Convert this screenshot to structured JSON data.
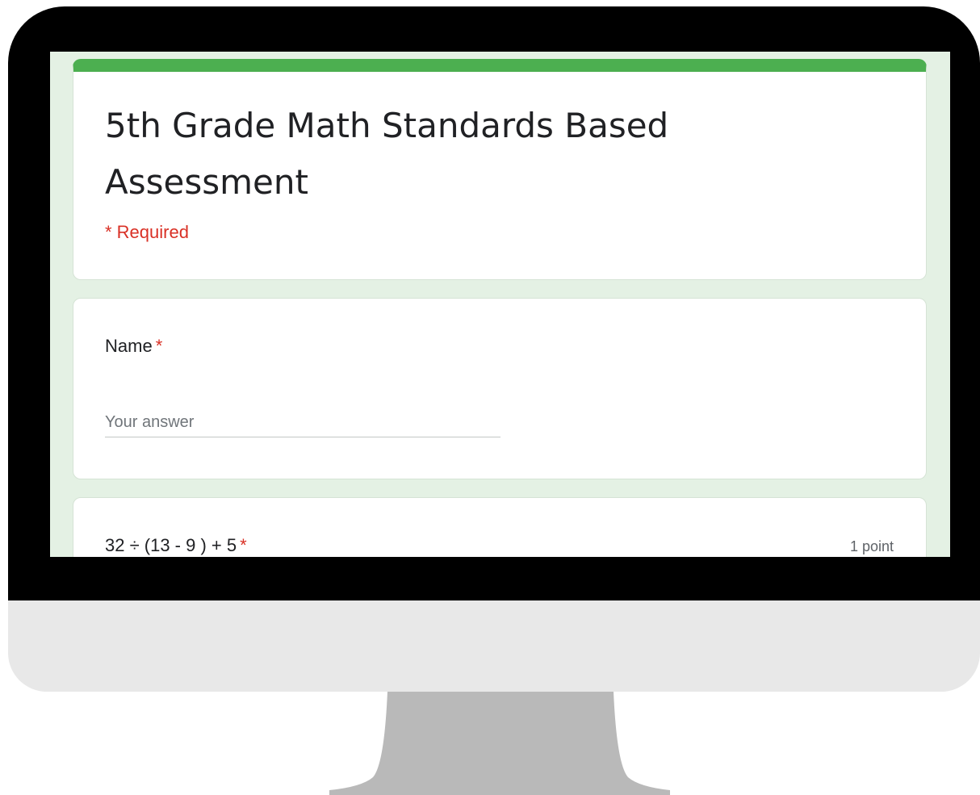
{
  "form": {
    "title": "5th Grade Math Standards Based Assessment",
    "required_note": "* Required",
    "accent_color": "#4caf50",
    "background_color": "#e4f1e4",
    "required_color": "#d93025"
  },
  "questions": [
    {
      "label": "Name",
      "required_marker": "*",
      "placeholder": "Your answer"
    },
    {
      "label": "32 ÷ (13 - 9 ) + 5",
      "required_marker": "*",
      "points": "1 point"
    }
  ]
}
